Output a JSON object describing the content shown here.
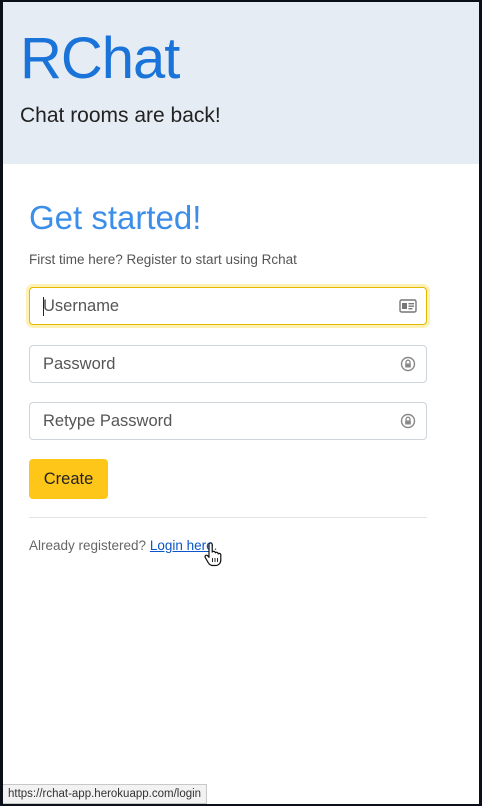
{
  "header": {
    "brand": "RChat",
    "tagline": "Chat rooms are back!"
  },
  "form": {
    "heading": "Get started!",
    "subtitle": "First time here? Register to start using Rchat",
    "username_placeholder": "Username",
    "password_placeholder": "Password",
    "retype_placeholder": "Retype Password",
    "create_label": "Create",
    "icons": {
      "username": "id-card-icon",
      "password": "lock-icon",
      "retype": "lock-icon"
    }
  },
  "footer": {
    "already_text": "Already registered?",
    "login_link": "Login here",
    "period": "."
  },
  "status_bar": {
    "url": "https://rchat-app.herokuapp.com/login"
  },
  "colors": {
    "brand": "#1a73d9",
    "heading": "#3d8ee8",
    "hero_bg": "#e6ecf3",
    "button": "#ffc61a",
    "focus_ring": "#e5b800",
    "link": "#0b57c9"
  }
}
